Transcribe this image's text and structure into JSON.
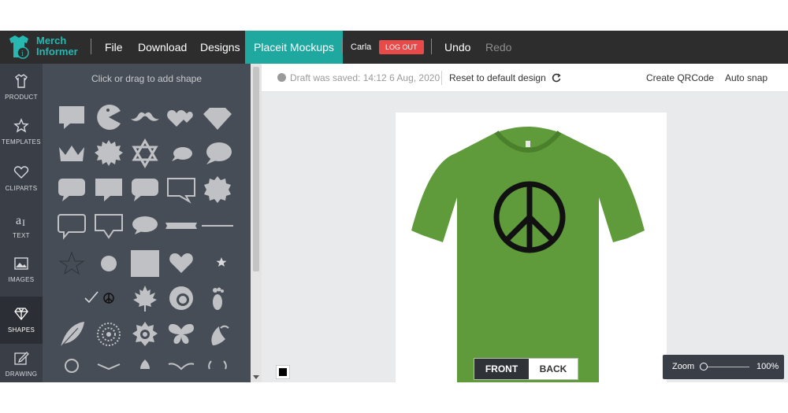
{
  "topbar": {
    "logo_line1": "Merch",
    "logo_line2": "Informer",
    "menu": [
      "File",
      "Download",
      "Designs",
      "Placeit Mockups"
    ],
    "user": "Carla",
    "logout": "LOG OUT",
    "undo": "Undo",
    "redo": "Redo"
  },
  "rail": {
    "items": [
      {
        "label": "PRODUCT",
        "icon": "tshirt-icon"
      },
      {
        "label": "TEMPLATES",
        "icon": "star-icon"
      },
      {
        "label": "CLIPARTS",
        "icon": "heart-icon"
      },
      {
        "label": "TEXT",
        "icon": "text-icon"
      },
      {
        "label": "IMAGES",
        "icon": "image-icon"
      },
      {
        "label": "SHAPES",
        "icon": "diamond-icon"
      },
      {
        "label": "DRAWING",
        "icon": "pencil-icon"
      }
    ],
    "active": "SHAPES"
  },
  "panel": {
    "hint": "Click or drag to add shape"
  },
  "subbar": {
    "draft": "Draft was saved: 14:12 6 Aug, 2020",
    "reset": "Reset to default design",
    "qr": "Create QRCode",
    "snap": "Auto snap"
  },
  "canvas": {
    "shirt_color": "#5f9b3b",
    "front": "FRONT",
    "back": "BACK",
    "swatch_color": "#000000"
  },
  "zoom": {
    "label": "Zoom",
    "value": "100%"
  },
  "colors": {
    "topbar": "#2d2d2d",
    "accent": "#1fa89f",
    "logout": "#e84a4a",
    "panel": "#474d56",
    "rail": "#3a3f47"
  }
}
